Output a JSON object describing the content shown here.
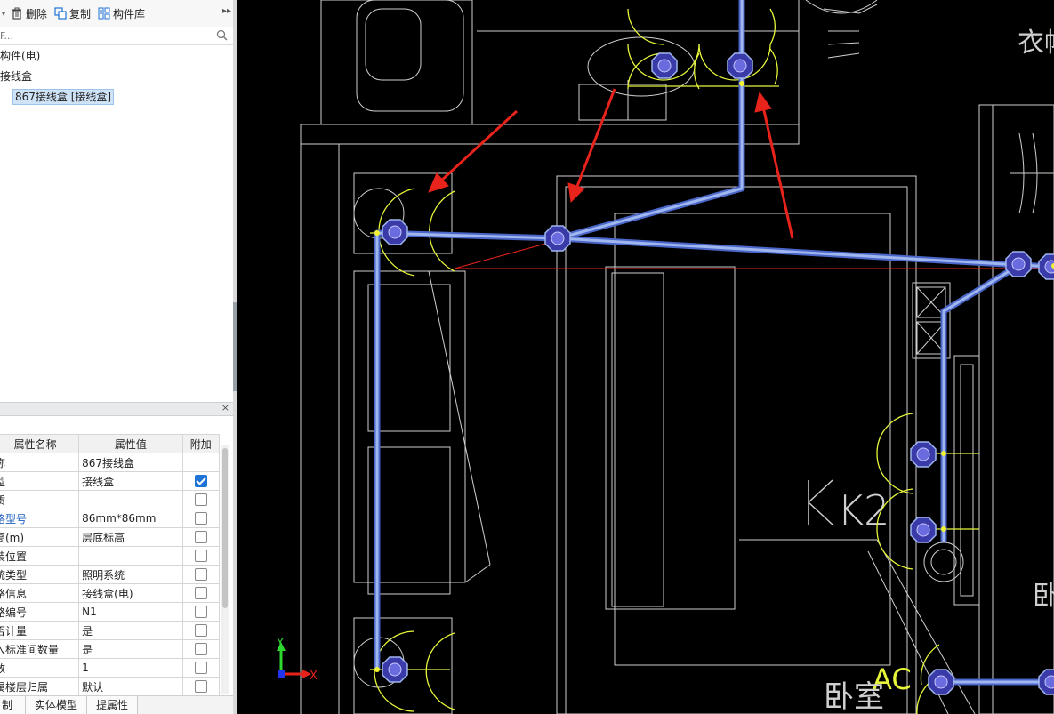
{
  "toolbar": {
    "delete_label": "删除",
    "copy_label": "复制",
    "library_label": "构件库",
    "more_glyph": "▸▸"
  },
  "search": {
    "placeholder": "F..."
  },
  "tree": {
    "items": [
      {
        "label": "构件(电)",
        "level": 0
      },
      {
        "label": "接线盒",
        "level": 0
      },
      {
        "label": "867接线盒 [接线盒]",
        "level": 1,
        "selected": true
      }
    ]
  },
  "properties": {
    "close_glyph": "×",
    "headers": [
      "属性名称",
      "属性值",
      "附加"
    ],
    "rows": [
      {
        "name": "称",
        "value": "867接线盒",
        "checked": null,
        "blue": false
      },
      {
        "name": "型",
        "value": "接线盒",
        "checked": true,
        "blue": false
      },
      {
        "name": "质",
        "value": "",
        "checked": false,
        "blue": false
      },
      {
        "name": "格型号",
        "value": "86mm*86mm",
        "checked": false,
        "blue": true
      },
      {
        "name": "高(m)",
        "value": "层底标高",
        "checked": false,
        "blue": false
      },
      {
        "name": "装位置",
        "value": "",
        "checked": false,
        "blue": false
      },
      {
        "name": "统类型",
        "value": "照明系统",
        "checked": false,
        "blue": false
      },
      {
        "name": "路信息",
        "value": "接线盒(电)",
        "checked": false,
        "blue": false
      },
      {
        "name": "路编号",
        "value": "N1",
        "checked": false,
        "blue": false
      },
      {
        "name": "否计量",
        "value": "是",
        "checked": false,
        "blue": false
      },
      {
        "name": "入标准间数量",
        "value": "是",
        "checked": false,
        "blue": false
      },
      {
        "name": "数",
        "value": "1",
        "checked": false,
        "blue": false
      },
      {
        "name": "属楼层归属",
        "value": "默认",
        "checked": false,
        "blue": false
      }
    ]
  },
  "bottom_tabs": [
    "制",
    "实体模型",
    "提属性"
  ],
  "canvas": {
    "labels": {
      "k2": "K2",
      "ac": "AC",
      "room": "卧室",
      "wardrobe": "衣帽",
      "bedroom_partial": "卧",
      "axis_x": "X",
      "axis_y": "Y"
    },
    "colors": {
      "background": "#000000",
      "pipe": "#7b9be0",
      "symbol_arc": "#e6f53a",
      "arrow": "#e8231b",
      "outline": "#d9d9d9",
      "box": "#3a3aa8"
    }
  }
}
